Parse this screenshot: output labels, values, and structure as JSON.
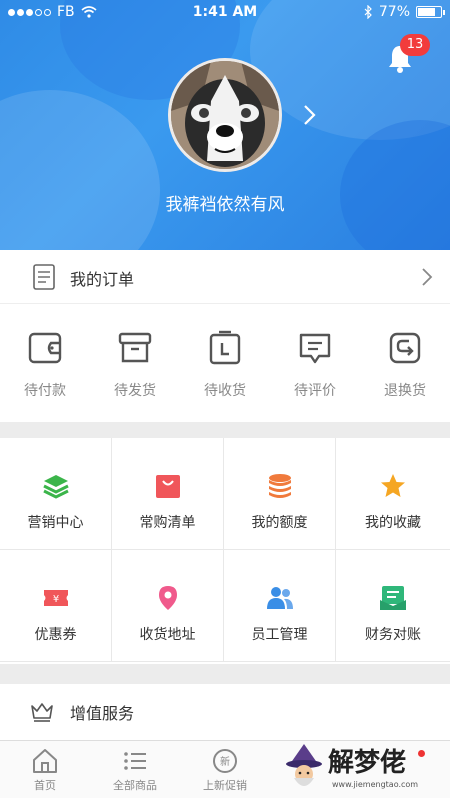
{
  "status_bar": {
    "carrier": "FB",
    "time": "1:41 AM",
    "battery": "77%",
    "battery_level": 0.77
  },
  "header": {
    "notification_count": "13",
    "username": "我裤裆依然有风"
  },
  "orders": {
    "title": "我的订单",
    "items": [
      {
        "label": "待付款",
        "icon": "wallet-icon"
      },
      {
        "label": "待发货",
        "icon": "box-icon"
      },
      {
        "label": "待收货",
        "icon": "calendar-icon"
      },
      {
        "label": "待评价",
        "icon": "comment-icon"
      },
      {
        "label": "退换货",
        "icon": "return-icon"
      }
    ]
  },
  "services": [
    {
      "label": "营销中心",
      "icon": "layers-icon",
      "color": "#3bb54a"
    },
    {
      "label": "常购清单",
      "icon": "bag-icon",
      "color": "#f0565a"
    },
    {
      "label": "我的额度",
      "icon": "coins-icon",
      "color": "#f07a3c"
    },
    {
      "label": "我的收藏",
      "icon": "star-icon",
      "color": "#f5a623"
    },
    {
      "label": "优惠券",
      "icon": "ticket-icon",
      "color": "#f0565a"
    },
    {
      "label": "收货地址",
      "icon": "location-pin-icon",
      "color": "#f05a8c"
    },
    {
      "label": "员工管理",
      "icon": "users-icon",
      "color": "#3a8ee6"
    },
    {
      "label": "财务对账",
      "icon": "finance-icon",
      "color": "#2fb77a"
    }
  ],
  "value_added": {
    "title": "增值服务"
  },
  "tabbar": [
    {
      "label": "首页",
      "icon": "home-icon"
    },
    {
      "label": "全部商品",
      "icon": "list-icon"
    },
    {
      "label": "上新促销",
      "icon": "new-badge-icon"
    }
  ],
  "watermark": {
    "title": "解梦佬",
    "url": "www.jiemengtao.com"
  }
}
